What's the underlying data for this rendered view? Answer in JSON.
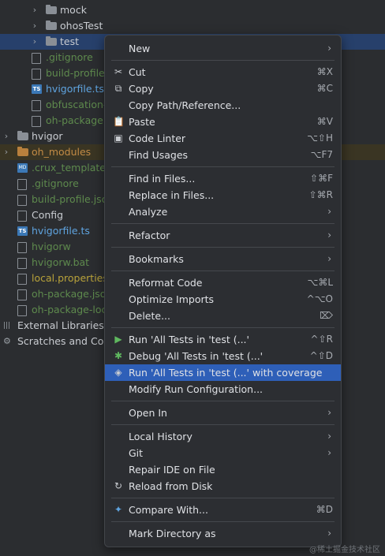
{
  "tree": {
    "rows": [
      {
        "label": "mock",
        "kind": "folder",
        "indent": 3,
        "chevron": "›"
      },
      {
        "label": "ohosTest",
        "kind": "folder",
        "indent": 3,
        "chevron": "›"
      },
      {
        "label": "test",
        "kind": "folder",
        "indent": 3,
        "chevron": "›",
        "selected": true
      },
      {
        "label": ".gitignore",
        "kind": "file",
        "indent": 3,
        "color": "green"
      },
      {
        "label": "build-profile.",
        "kind": "file",
        "indent": 3,
        "color": "green"
      },
      {
        "label": "hvigorfile.ts",
        "kind": "ts",
        "indent": 3,
        "color": "blue"
      },
      {
        "label": "obfuscation-",
        "kind": "file",
        "indent": 3,
        "color": "green"
      },
      {
        "label": "oh-package.",
        "kind": "file",
        "indent": 3,
        "color": "green"
      },
      {
        "label": "hvigor",
        "kind": "folder",
        "indent": 0,
        "chevron": "›"
      },
      {
        "label": "oh_modules",
        "kind": "folder-orange",
        "indent": 0,
        "chevron": "›",
        "color": "orange",
        "highlight": true
      },
      {
        "label": ".crux_template.",
        "kind": "md",
        "indent": 1,
        "color": "green"
      },
      {
        "label": ".gitignore",
        "kind": "file",
        "indent": 1,
        "color": "green"
      },
      {
        "label": "build-profile.json",
        "kind": "file",
        "indent": 1,
        "color": "green"
      },
      {
        "label": "Config",
        "kind": "file",
        "indent": 1
      },
      {
        "label": "hvigorfile.ts",
        "kind": "ts",
        "indent": 1,
        "color": "blue"
      },
      {
        "label": "hvigorw",
        "kind": "file",
        "indent": 1,
        "color": "green"
      },
      {
        "label": "hvigorw.bat",
        "kind": "file",
        "indent": 1,
        "color": "green"
      },
      {
        "label": "local.properties",
        "kind": "file",
        "indent": 1,
        "color": "yellow"
      },
      {
        "label": "oh-package.json",
        "kind": "file",
        "indent": 1,
        "color": "green"
      },
      {
        "label": "oh-package-loc",
        "kind": "file",
        "indent": 1,
        "color": "green"
      },
      {
        "label": "External Libraries",
        "kind": "lib",
        "indent": -1
      },
      {
        "label": "Scratches and Cor",
        "kind": "scratch",
        "indent": -1
      }
    ]
  },
  "menu": {
    "items": [
      {
        "type": "item",
        "label": "New",
        "arrow": "›"
      },
      {
        "type": "sep"
      },
      {
        "type": "item",
        "label": "Cut",
        "shortcut": "⌘X",
        "icon": "✂",
        "icon_name": "scissors-icon"
      },
      {
        "type": "item",
        "label": "Copy",
        "shortcut": "⌘C",
        "icon": "⧉",
        "icon_name": "copy-icon"
      },
      {
        "type": "item",
        "label": "Copy Path/Reference..."
      },
      {
        "type": "item",
        "label": "Paste",
        "shortcut": "⌘V",
        "icon": "📋",
        "icon_name": "clipboard-icon"
      },
      {
        "type": "item",
        "label": "Code Linter",
        "shortcut": "⌥⇧H",
        "icon": "▣",
        "icon_name": "linter-icon"
      },
      {
        "type": "item",
        "label": "Find Usages",
        "shortcut": "⌥F7"
      },
      {
        "type": "sep"
      },
      {
        "type": "item",
        "label": "Find in Files...",
        "shortcut": "⇧⌘F"
      },
      {
        "type": "item",
        "label": "Replace in Files...",
        "shortcut": "⇧⌘R"
      },
      {
        "type": "item",
        "label": "Analyze",
        "arrow": "›"
      },
      {
        "type": "sep"
      },
      {
        "type": "item",
        "label": "Refactor",
        "arrow": "›"
      },
      {
        "type": "sep"
      },
      {
        "type": "item",
        "label": "Bookmarks",
        "arrow": "›"
      },
      {
        "type": "sep"
      },
      {
        "type": "item",
        "label": "Reformat Code",
        "shortcut": "⌥⌘L"
      },
      {
        "type": "item",
        "label": "Optimize Imports",
        "shortcut": "^⌥O"
      },
      {
        "type": "item",
        "label": "Delete...",
        "shortcut": "⌦"
      },
      {
        "type": "sep"
      },
      {
        "type": "item",
        "label": "Run 'All Tests in 'test (...'",
        "shortcut": "^⇧R",
        "icon": "▶",
        "icon_name": "run-icon",
        "icon_color": "#5fb85f"
      },
      {
        "type": "item",
        "label": "Debug 'All Tests in 'test (...'",
        "shortcut": "^⇧D",
        "icon": "✱",
        "icon_name": "debug-icon",
        "icon_color": "#5fb85f"
      },
      {
        "type": "item",
        "label": "Run 'All Tests in 'test (...' with coverage",
        "icon": "◈",
        "icon_name": "coverage-icon",
        "highlight": true
      },
      {
        "type": "item",
        "label": "Modify Run Configuration..."
      },
      {
        "type": "sep"
      },
      {
        "type": "item",
        "label": "Open In",
        "arrow": "›"
      },
      {
        "type": "sep"
      },
      {
        "type": "item",
        "label": "Local History",
        "arrow": "›"
      },
      {
        "type": "item",
        "label": "Git",
        "arrow": "›"
      },
      {
        "type": "item",
        "label": "Repair IDE on File"
      },
      {
        "type": "item",
        "label": "Reload from Disk",
        "icon": "↻",
        "icon_name": "reload-icon"
      },
      {
        "type": "sep"
      },
      {
        "type": "item",
        "label": "Compare With...",
        "shortcut": "⌘D",
        "icon": "✦",
        "icon_name": "compare-icon",
        "icon_color": "#5fa4e0"
      },
      {
        "type": "sep"
      },
      {
        "type": "item",
        "label": "Mark Directory as",
        "arrow": "›"
      }
    ]
  },
  "watermark": "@稀土掘金技术社区"
}
